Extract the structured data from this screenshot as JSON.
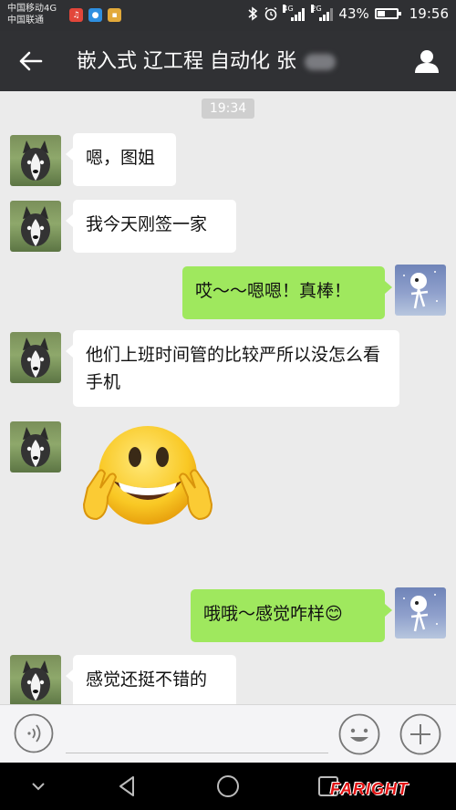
{
  "status": {
    "carrier_1": "中国移动4G",
    "carrier_2": "中国联通",
    "net_4g": "4G",
    "net_2g": "2G",
    "battery_text": "43%",
    "battery_level": 0.43,
    "time": "19:56"
  },
  "title": "嵌入式 辽工程 自动化 张",
  "chat": {
    "timestamp": "19:34",
    "messages": [
      {
        "side": "left",
        "text": "嗯，图姐"
      },
      {
        "side": "left",
        "text": "我今天刚签一家"
      },
      {
        "side": "right",
        "text": "哎～～嗯嗯！真棒！"
      },
      {
        "side": "left",
        "text": "他们上班时间管的比较严所以没怎么看手机"
      },
      {
        "side": "left",
        "sticker": "grinning-victory-emoji"
      },
      {
        "side": "right",
        "text": "哦哦～感觉咋样😊"
      },
      {
        "side": "left",
        "text": "感觉还挺不错的"
      }
    ]
  },
  "watermark": "FARIGHT",
  "colors": {
    "header": "#303134",
    "chat_bg": "#ebebeb",
    "bubble_sent": "#9fe85e",
    "bubble_received": "#ffffff"
  }
}
